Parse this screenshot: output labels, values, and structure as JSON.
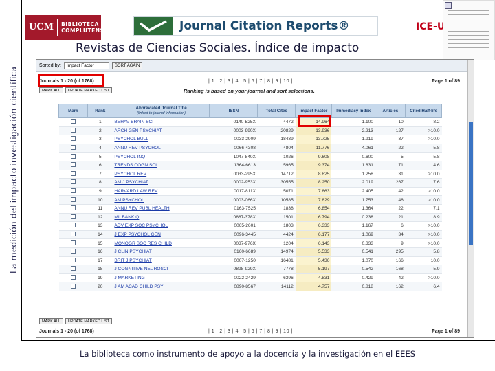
{
  "slide": {
    "vertical_title": "La medición del impacto investigación científica",
    "subtitle": "Revistas de Ciencias Sociales. Índice de impacto",
    "tag": "ICE-UCM",
    "footer": "La biblioteca como instrumento de apoyo a la docencia y la investigación en el EEES"
  },
  "logo": {
    "ucm": "UCM",
    "line1": "BIBLIOTECA",
    "line2": "COMPLUTENSE"
  },
  "banner": {
    "title": "Journal Citation Reports®",
    "accent": "#2d6e3a"
  },
  "screen": {
    "sorted_by_label": "Sorted by:",
    "sorted_by_value": "Impact Factor",
    "sort_again": "SORT AGAIN",
    "journals_range": "Journals 1 - 20 (of 1768)",
    "pages": "| 1 | 2 | 3 | 4 | 5 | 6 | 7 | 8 | 9 | 10 |",
    "page_of": "Page 1 of 89",
    "mark_all": "MARK ALL",
    "update_marked": "UPDATE MARKED LIST",
    "rank_note": "Ranking is based on your journal and sort selections.",
    "columns": [
      "Mark",
      "Rank",
      "Abbreviated Journal Title",
      "ISSN",
      "Total Cites",
      "Impact Factor",
      "Immediacy Index",
      "Articles",
      "Cited Half-life"
    ],
    "column_subnote": "(linked to journal information)",
    "rows": [
      [
        "1",
        "BEHAV BRAIN SCI",
        "0140-525X",
        "4472",
        "14.964",
        "1.100",
        "10",
        "8.2"
      ],
      [
        "2",
        "ARCH GEN PSYCHIAT",
        "0003-990X",
        "20829",
        "13.936",
        "2.213",
        "127",
        ">10.0"
      ],
      [
        "3",
        "PSYCHOL BULL",
        "0033-2909",
        "18439",
        "13.725",
        "1.919",
        "37",
        ">10.0"
      ],
      [
        "4",
        "ANNU REV PSYCHOL",
        "0066-4308",
        "4804",
        "11.776",
        "4.061",
        "22",
        "5.8"
      ],
      [
        "5",
        "PSYCHOL INQ",
        "1047-840X",
        "1026",
        "9.608",
        "0.600",
        "5",
        "5.8"
      ],
      [
        "6",
        "TRENDS COGN SCI",
        "1364-6613",
        "5965",
        "9.374",
        "1.831",
        "71",
        "4.6"
      ],
      [
        "7",
        "PSYCHOL REV",
        "0033-295X",
        "14712",
        "8.825",
        "1.258",
        "31",
        ">10.0"
      ],
      [
        "8",
        "AM J PSYCHIAT",
        "0002-953X",
        "30555",
        "8.250",
        "2.019",
        "267",
        "7.6"
      ],
      [
        "9",
        "HARVARD LAW REV",
        "0017-811X",
        "5071",
        "7.863",
        "2.405",
        "42",
        ">10.0"
      ],
      [
        "10",
        "AM PSYCHOL",
        "0003-066X",
        "10585",
        "7.829",
        "1.753",
        "46",
        ">10.0"
      ],
      [
        "11",
        "ANNU REV PUBL HEALTH",
        "0163-7525",
        "1838",
        "6.854",
        "1.364",
        "22",
        "7.1"
      ],
      [
        "12",
        "MILBANK Q",
        "0887-378X",
        "1501",
        "6.794",
        "0.238",
        "21",
        "8.9"
      ],
      [
        "13",
        "ADV EXP SOC PSYCHOL",
        "0065-2601",
        "1803",
        "6.333",
        "1.167",
        "6",
        ">10.0"
      ],
      [
        "14",
        "J EXP PSYCHOL GEN",
        "0096-3445",
        "4424",
        "6.177",
        "1.069",
        "34",
        ">10.0"
      ],
      [
        "15",
        "MONOGR SOC RES CHILD",
        "0037-976X",
        "1204",
        "6.143",
        "0.333",
        "9",
        ">10.0"
      ],
      [
        "16",
        "J CLIN PSYCHIAT",
        "0160-6689",
        "14974",
        "5.533",
        "0.541",
        "295",
        "5.8"
      ],
      [
        "17",
        "BRIT J PSYCHIAT",
        "0007-1250",
        "16481",
        "5.436",
        "1.070",
        "166",
        "10.0"
      ],
      [
        "18",
        "J COGNITIVE NEUROSCI",
        "0898-929X",
        "7778",
        "5.197",
        "0.542",
        "168",
        "5.9"
      ],
      [
        "19",
        "J MARKETING",
        "0022-2429",
        "6396",
        "4.831",
        "0.429",
        "42",
        ">10.0"
      ],
      [
        "20",
        "J AM ACAD CHILD PSY",
        "0890-8567",
        "14112",
        "4.757",
        "0.818",
        "162",
        "6.4"
      ]
    ]
  }
}
